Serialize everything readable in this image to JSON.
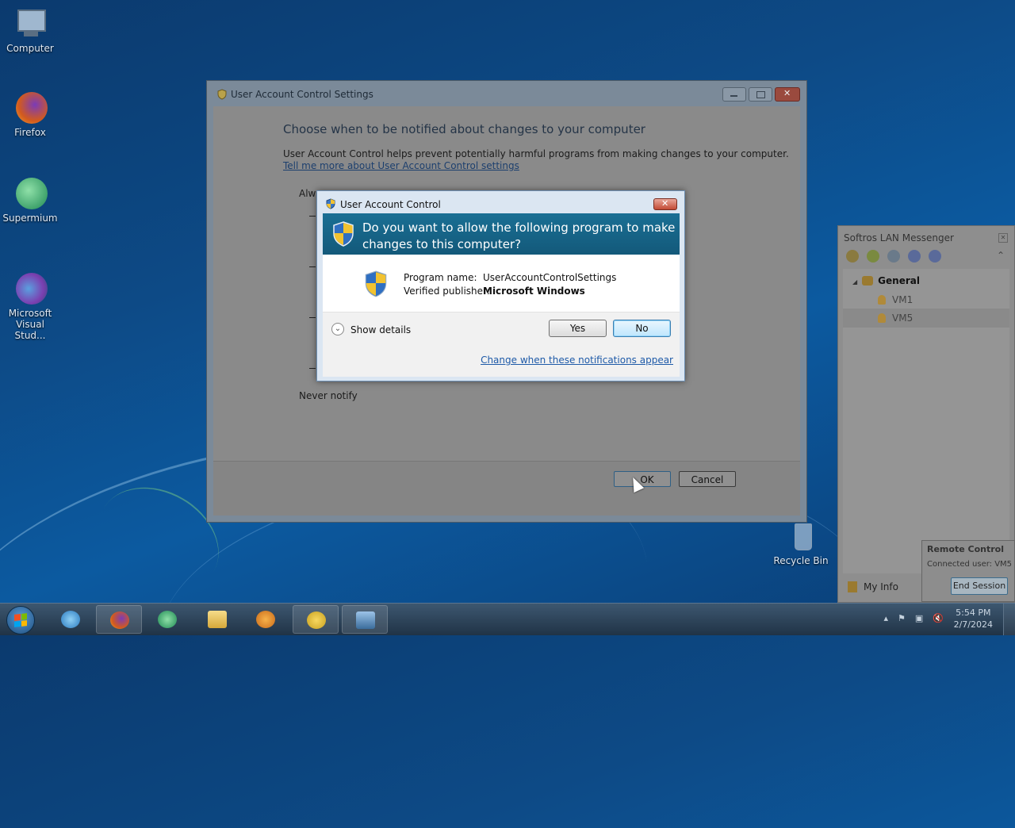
{
  "desktop": {
    "icons": [
      {
        "label": "Computer"
      },
      {
        "label": "Firefox"
      },
      {
        "label": "Supermium"
      },
      {
        "label": "Microsoft Visual Stud..."
      },
      {
        "label": "Recycle Bin"
      }
    ]
  },
  "settings_window": {
    "title": "User Account Control Settings",
    "heading": "Choose when to be notified about changes to your computer",
    "description": "User Account Control helps prevent potentially harmful programs from making changes to your computer.",
    "link": "Tell me more about User Account Control settings",
    "slider_top_label": "Alwa",
    "slider_bottom_label": "Never notify",
    "ok_label": "OK",
    "cancel_label": "Cancel"
  },
  "uac_dialog": {
    "title": "User Account Control",
    "question": "Do you want to allow the following program to make changes to this computer?",
    "program_label": "Program name:",
    "program_value": "UserAccountControlSettings",
    "publisher_label": "Verified publisher:",
    "publisher_value": "Microsoft Windows",
    "show_details": "Show details",
    "yes_label": "Yes",
    "no_label": "No",
    "change_link": "Change when these notifications appear"
  },
  "lan_messenger": {
    "title": "Softros LAN Messenger",
    "group": "General",
    "users": [
      "VM1",
      "VM5"
    ],
    "my_info": "My Info"
  },
  "remote_control": {
    "title": "Remote Control",
    "connected": "Connected user: VM5",
    "end_label": "End Session"
  },
  "taskbar": {
    "time": "5:54 PM",
    "date": "2/7/2024"
  }
}
